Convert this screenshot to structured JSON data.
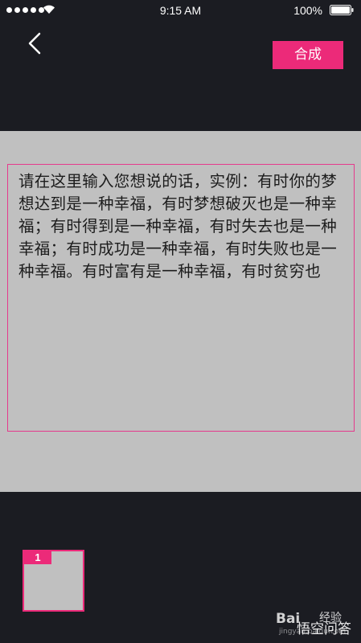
{
  "status_bar": {
    "time": "9:15 AM",
    "battery": "100%"
  },
  "header": {
    "compose_label": "合成"
  },
  "editor": {
    "text": "请在这里输入您想说的话，实例：有时你的梦想达到是一种幸福，有时梦想破灭也是一种幸福；有时得到是一种幸福，有时失去也是一种幸福；有时成功是一种幸福，有时失败也是一种幸福。有时富有是一种幸福，有时贫穷也"
  },
  "pages": [
    {
      "number": "1"
    }
  ],
  "watermark": {
    "logo": "Bai",
    "jingyan": "经验",
    "sub": "jingyan.baidu.com",
    "text": "悟空问答"
  },
  "colors": {
    "background": "#1b1c22",
    "accent": "#ec2a79",
    "canvas": "#c0c0c0",
    "text_border": "#e53a8c"
  },
  "icons": {
    "back": "chevron-left-icon",
    "signal": "signal-dots-icon",
    "wifi": "wifi-icon",
    "battery": "battery-icon"
  }
}
